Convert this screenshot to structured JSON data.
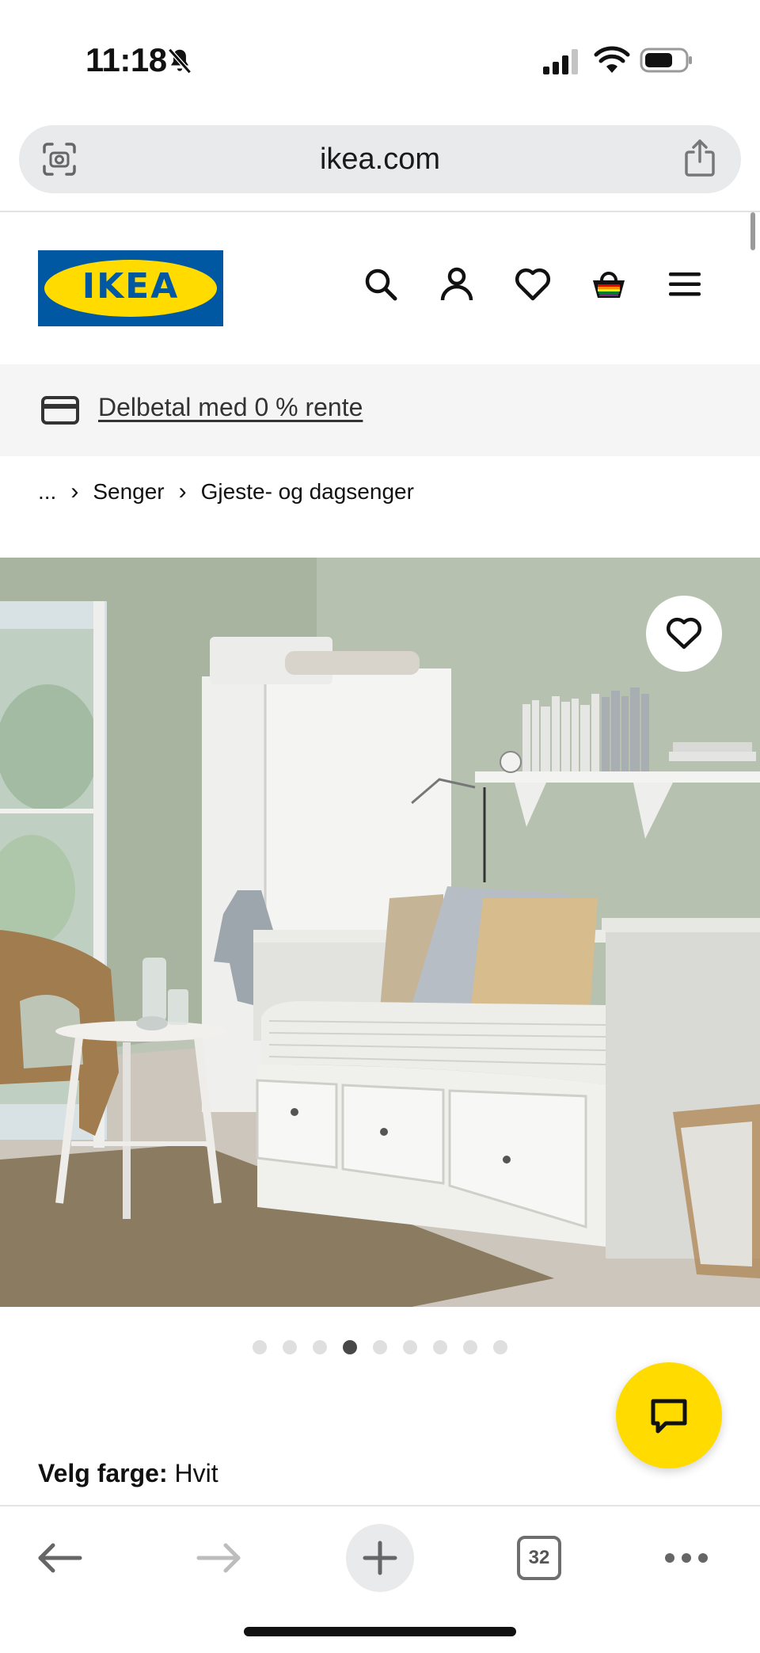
{
  "status": {
    "time": "11:18"
  },
  "browser": {
    "url": "ikea.com",
    "tab_count": "32"
  },
  "header": {
    "logo_text": "IKEA",
    "brand_blue": "#0058a3",
    "brand_yellow": "#ffdb00"
  },
  "promo": {
    "text": "Delbetal med 0 % rente"
  },
  "breadcrumb": {
    "ellipsis": "...",
    "items": [
      "Senger",
      "Gjeste- og dagsenger"
    ],
    "separator": "›"
  },
  "gallery": {
    "dot_count": 9,
    "active_index": 3
  },
  "product": {
    "color_label": "Velg farge:",
    "color_value": "Hvit"
  },
  "icons": [
    "bell-off-icon",
    "cellular-signal-icon",
    "wifi-icon",
    "battery-icon",
    "camera-scan-icon",
    "share-icon",
    "search-icon",
    "account-icon",
    "heart-icon",
    "cart-icon",
    "menu-icon",
    "credit-card-icon",
    "chat-icon",
    "back-icon",
    "forward-icon",
    "plus-icon",
    "tabs-icon",
    "more-icon"
  ]
}
